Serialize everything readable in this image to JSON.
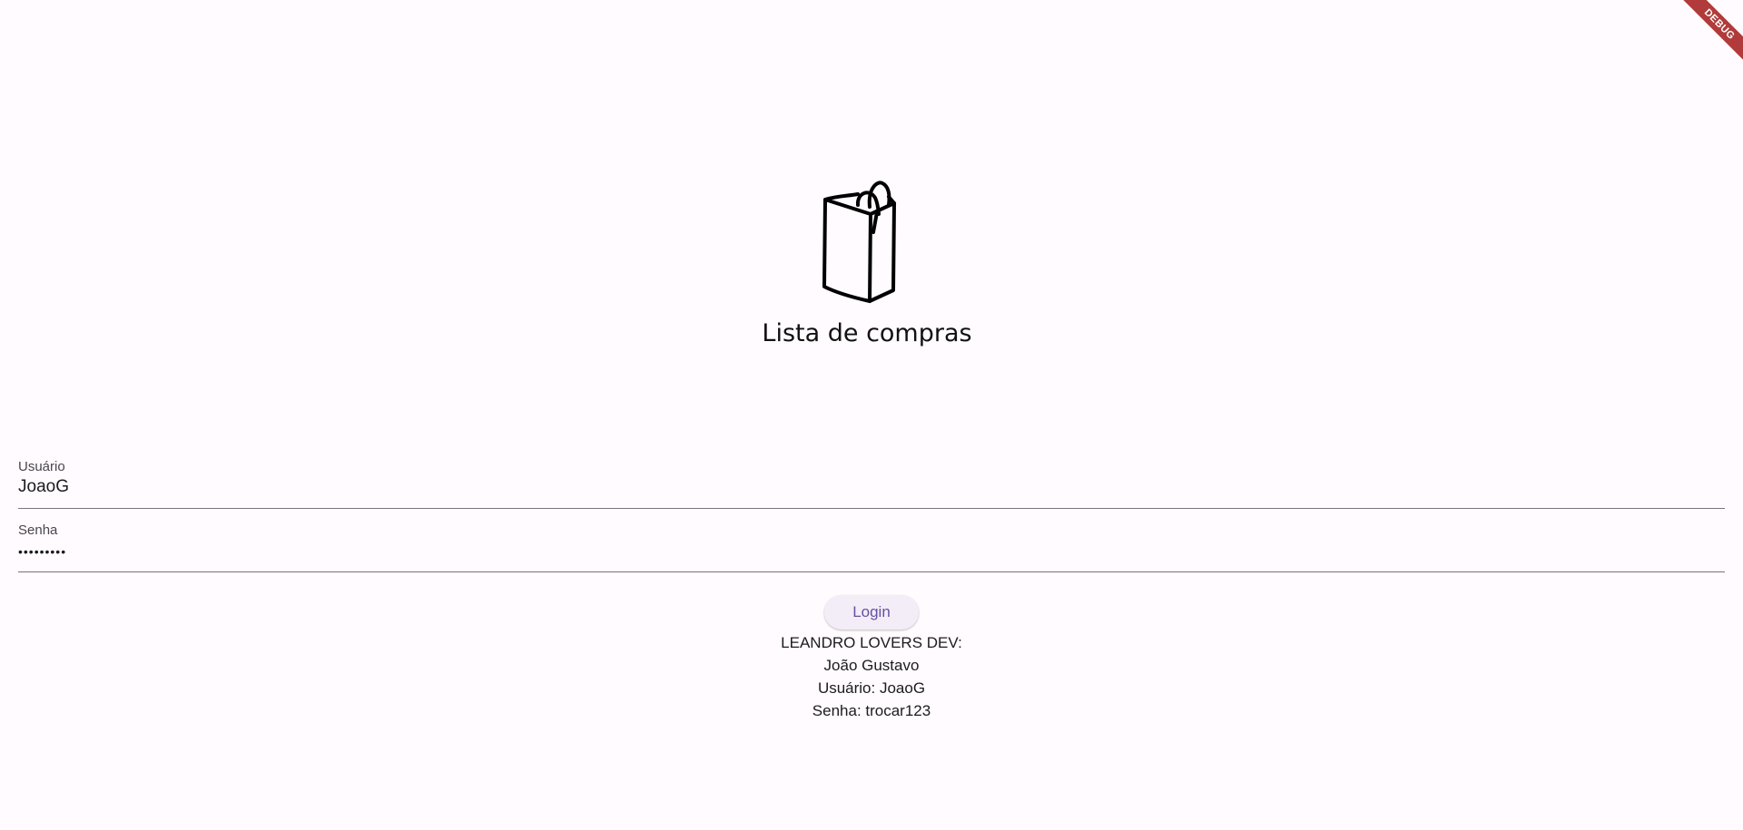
{
  "app": {
    "title": "Lista de compras",
    "debug_banner": "DEBUG"
  },
  "icons": {
    "logo": "shopping-bag-icon"
  },
  "form": {
    "user_label": "Usuário",
    "user_value": "JoaoG",
    "password_label": "Senha",
    "password_value": "•••••••••",
    "login_label": "Login"
  },
  "info": {
    "line1": "LEANDRO LOVERS DEV:",
    "line2": "João Gustavo",
    "line3": "Usuário: JoaoG",
    "line4": "Senha: trocar123"
  },
  "colors": {
    "background": "#fffbfe",
    "accent": "#6750a4",
    "button_bg": "#f3edf7",
    "debug": "#b13a3a"
  }
}
